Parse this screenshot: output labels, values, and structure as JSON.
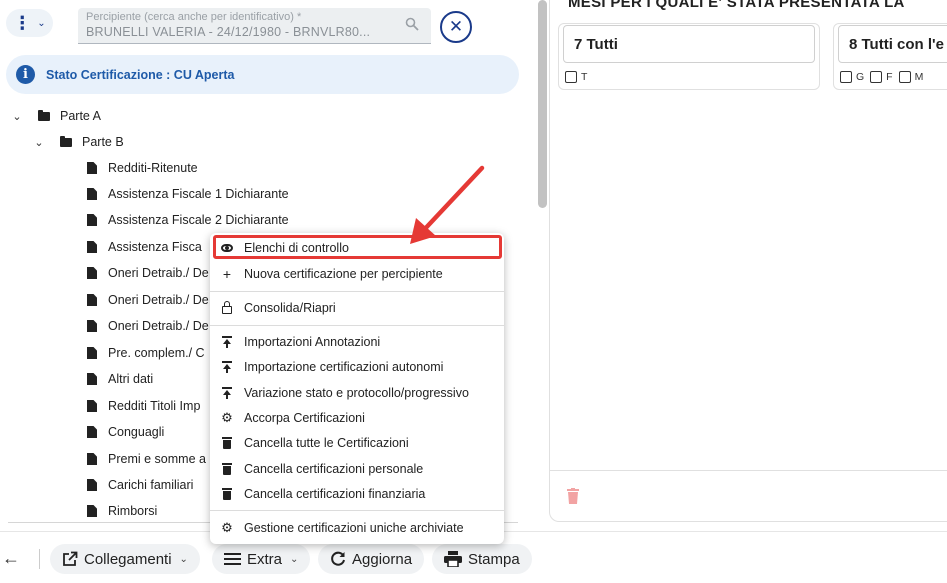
{
  "search": {
    "placeholder_label": "Percipiente (cerca anche per identificativo) *",
    "value": "BRUNELLI VALERIA - 24/12/1980 - BRNVLR80..."
  },
  "status": {
    "text": "Stato Certificazione : CU Aperta"
  },
  "tree": {
    "parte_a": "Parte A",
    "parte_b": "Parte B",
    "items": [
      "Redditi-Ritenute",
      "Assistenza Fiscale 1 Dichiarante",
      "Assistenza Fiscale 2 Dichiarante",
      "Assistenza Fisca",
      "Oneri Detraib./ De",
      "Oneri Detraib./ De",
      "Oneri Detraib./ De",
      "Pre. complem./ C",
      "Altri dati",
      "Redditi Titoli Imp",
      "Conguagli",
      "Premi e somme a",
      "Carichi familiari",
      "Rimborsi"
    ]
  },
  "right": {
    "title": "MESI PER I QUALI E' STATA PRESENTATA LA",
    "card1": {
      "value": "7 Tutti",
      "checks": [
        "T"
      ]
    },
    "card2": {
      "value": "8 Tutti con l'e",
      "checks": [
        "G",
        "F",
        "M"
      ]
    }
  },
  "menu": {
    "items": [
      {
        "label": "Elenchi di controllo",
        "icon": "eye-icon"
      },
      {
        "label": "Nuova certificazione per percipiente",
        "icon": "plus-icon"
      },
      {
        "label": "Consolida/Riapri",
        "icon": "lock-icon"
      },
      {
        "label": "Importazioni Annotazioni",
        "icon": "upload-icon"
      },
      {
        "label": "Importazione certificazioni autonomi",
        "icon": "upload-icon"
      },
      {
        "label": "Variazione stato e protocollo/progressivo",
        "icon": "upload-icon"
      },
      {
        "label": "Accorpa Certificazioni",
        "icon": "gear-icon"
      },
      {
        "label": "Cancella tutte le Certificazioni",
        "icon": "trash-icon"
      },
      {
        "label": "Cancella certificazioni personale",
        "icon": "trash-icon"
      },
      {
        "label": "Cancella certificazioni finanziaria",
        "icon": "trash-icon"
      },
      {
        "label": "Gestione certificazioni uniche archiviate",
        "icon": "gear-icon"
      }
    ]
  },
  "toolbar": {
    "collegamenti": "Collegamenti",
    "extra": "Extra",
    "aggiorna": "Aggiorna",
    "stampa": "Stampa"
  },
  "colors": {
    "primary": "#1a3a8a",
    "info": "#1e5aa8",
    "highlight": "#e53935"
  }
}
